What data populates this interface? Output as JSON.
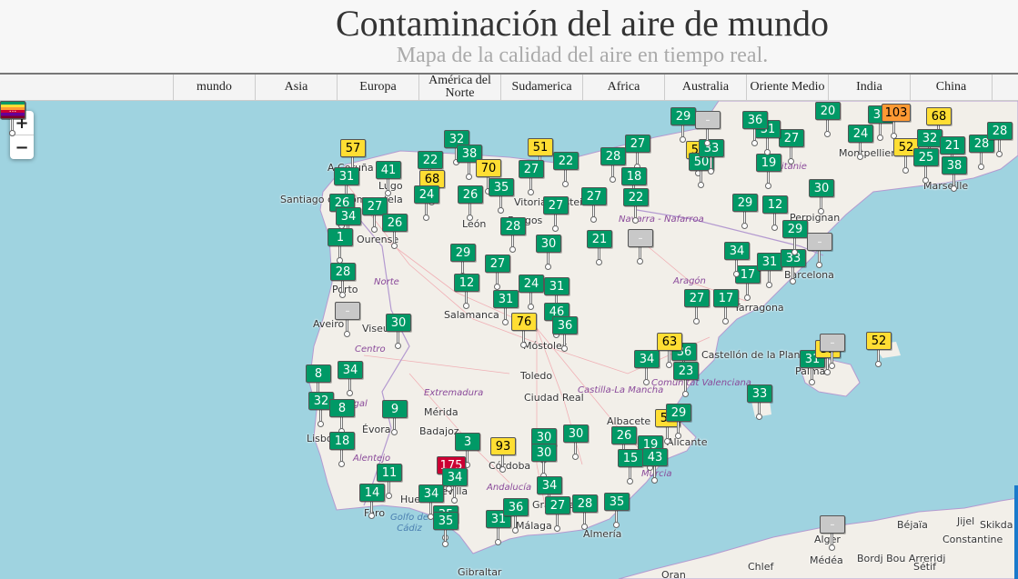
{
  "header": {
    "title": "Contaminación del aire de mundo",
    "subtitle": "Mapa de la calidad del aire en tiempo real."
  },
  "nav": {
    "items": [
      {
        "label": "mundo"
      },
      {
        "label": "Asia"
      },
      {
        "label": "Europa"
      },
      {
        "label": "América del Norte"
      },
      {
        "label": "Sudamerica"
      },
      {
        "label": "Africa"
      },
      {
        "label": "Australia"
      },
      {
        "label": "Oriente Medio"
      },
      {
        "label": "India"
      },
      {
        "label": "China"
      },
      {
        "label": ""
      }
    ]
  },
  "map": {
    "zoom_in_label": "+",
    "zoom_out_label": "−",
    "colors": {
      "good": "#009966",
      "moderate": "#ffde33",
      "unhealthy_sensitive": "#ff9933",
      "unhealthy": "#cc0033",
      "sea": "#9fd3e0",
      "land": "#f2efe9"
    },
    "places": [
      {
        "name": "A Coruña"
      },
      {
        "name": "Lugo"
      },
      {
        "name": "Santiago de Compostela"
      },
      {
        "name": "Ourense"
      },
      {
        "name": "León"
      },
      {
        "name": "Vitoria-Gasteiz"
      },
      {
        "name": "Burgos"
      },
      {
        "name": "Salamanca"
      },
      {
        "name": "Porto"
      },
      {
        "name": "Aveiro"
      },
      {
        "name": "Viseu"
      },
      {
        "name": "Móstoles"
      },
      {
        "name": "Toledo"
      },
      {
        "name": "Ciudad Real"
      },
      {
        "name": "Mérida"
      },
      {
        "name": "Badajoz"
      },
      {
        "name": "Évora"
      },
      {
        "name": "Lisboa"
      },
      {
        "name": "Córdoba"
      },
      {
        "name": "Sevilla"
      },
      {
        "name": "Huelva"
      },
      {
        "name": "Faro"
      },
      {
        "name": "Albacete"
      },
      {
        "name": "Alicante"
      },
      {
        "name": "Málaga"
      },
      {
        "name": "Almería"
      },
      {
        "name": "Granada"
      },
      {
        "name": "Gibraltar"
      },
      {
        "name": "Tarragona"
      },
      {
        "name": "Barcelona"
      },
      {
        "name": "Perpignan"
      },
      {
        "name": "Montpellier"
      },
      {
        "name": "Marseille"
      },
      {
        "name": "Palma"
      },
      {
        "name": "Castellón de la Plana"
      },
      {
        "name": "Alger"
      },
      {
        "name": "Béjaïa"
      },
      {
        "name": "Jijel"
      },
      {
        "name": "Skikda"
      },
      {
        "name": "Constantine"
      },
      {
        "name": "Chlef"
      },
      {
        "name": "Médéa"
      },
      {
        "name": "Bordj Bou Arreridj"
      },
      {
        "name": "Sétif"
      },
      {
        "name": "Oran"
      }
    ],
    "regions": [
      {
        "name": "Norte"
      },
      {
        "name": "Centro"
      },
      {
        "name": "Alentejo"
      },
      {
        "name": "Extremadura"
      },
      {
        "name": "Castilla-La Mancha"
      },
      {
        "name": "Andalucía"
      },
      {
        "name": "Aragón"
      },
      {
        "name": "Navarra - Nafarroa"
      },
      {
        "name": "Comunitat Valenciana"
      },
      {
        "name": "Murcia"
      },
      {
        "name": "Occitanie"
      },
      {
        "name": "Portugal"
      }
    ],
    "sea_labels": [
      {
        "name": "Golfo de Cádiz"
      }
    ],
    "markers": [
      {
        "value": "57",
        "level": "moderate"
      },
      {
        "value": "31",
        "level": "good"
      },
      {
        "value": "41",
        "level": "good"
      },
      {
        "value": "26",
        "level": "good"
      },
      {
        "value": "27",
        "level": "good"
      },
      {
        "value": "34",
        "level": "good"
      },
      {
        "value": "26",
        "level": "good"
      },
      {
        "value": "1",
        "level": "good"
      },
      {
        "value": "32",
        "level": "good"
      },
      {
        "value": "22",
        "level": "good"
      },
      {
        "value": "38",
        "level": "good"
      },
      {
        "value": "68",
        "level": "moderate"
      },
      {
        "value": "70",
        "level": "moderate"
      },
      {
        "value": "24",
        "level": "good"
      },
      {
        "value": "26",
        "level": "good"
      },
      {
        "value": "35",
        "level": "good"
      },
      {
        "value": "28",
        "level": "good"
      },
      {
        "value": "51",
        "level": "moderate"
      },
      {
        "value": "27",
        "level": "good"
      },
      {
        "value": "27",
        "level": "good"
      },
      {
        "value": "22",
        "level": "good"
      },
      {
        "value": "28",
        "level": "good"
      },
      {
        "value": "27",
        "level": "good"
      },
      {
        "value": "27",
        "level": "good"
      },
      {
        "value": "18",
        "level": "good"
      },
      {
        "value": "22",
        "level": "good"
      },
      {
        "value": "21",
        "level": "good"
      },
      {
        "value": "30",
        "level": "good"
      },
      {
        "value": "29",
        "level": "good"
      },
      {
        "value": "27",
        "level": "good"
      },
      {
        "value": "12",
        "level": "good"
      },
      {
        "value": "24",
        "level": "good"
      },
      {
        "value": "31",
        "level": "good"
      },
      {
        "value": "31",
        "level": "good"
      },
      {
        "value": "46",
        "level": "good"
      },
      {
        "value": "76",
        "level": "moderate"
      },
      {
        "value": "36",
        "level": "good"
      },
      {
        "value": "28",
        "level": "good"
      },
      {
        "value": "30",
        "level": "good"
      },
      {
        "value": "8",
        "level": "good"
      },
      {
        "value": "34",
        "level": "good"
      },
      {
        "value": "32",
        "level": "good"
      },
      {
        "value": "8",
        "level": "good"
      },
      {
        "value": "9",
        "level": "good"
      },
      {
        "value": "18",
        "level": "good"
      },
      {
        "value": "3",
        "level": "good"
      },
      {
        "value": "93",
        "level": "moderate"
      },
      {
        "value": "30",
        "level": "good"
      },
      {
        "value": "30",
        "level": "good"
      },
      {
        "value": "30",
        "level": "good"
      },
      {
        "value": "175",
        "level": "unhealthy"
      },
      {
        "value": "11",
        "level": "good"
      },
      {
        "value": "14",
        "level": "good"
      },
      {
        "value": "34",
        "level": "good"
      },
      {
        "value": "34",
        "level": "good"
      },
      {
        "value": "35",
        "level": "good"
      },
      {
        "value": "35",
        "level": "good"
      },
      {
        "value": "31",
        "level": "good"
      },
      {
        "value": "36",
        "level": "good"
      },
      {
        "value": "34",
        "level": "good"
      },
      {
        "value": "27",
        "level": "good"
      },
      {
        "value": "28",
        "level": "good"
      },
      {
        "value": "35",
        "level": "good"
      },
      {
        "value": "26",
        "level": "good"
      },
      {
        "value": "19",
        "level": "good"
      },
      {
        "value": "15",
        "level": "good"
      },
      {
        "value": "43",
        "level": "good"
      },
      {
        "value": "55",
        "level": "moderate"
      },
      {
        "value": "29",
        "level": "good"
      },
      {
        "value": "34",
        "level": "good"
      },
      {
        "value": "36",
        "level": "good"
      },
      {
        "value": "63",
        "level": "moderate"
      },
      {
        "value": "23",
        "level": "good"
      },
      {
        "value": "27",
        "level": "good"
      },
      {
        "value": "17",
        "level": "good"
      },
      {
        "value": "17",
        "level": "good"
      },
      {
        "value": "31",
        "level": "good"
      },
      {
        "value": "33",
        "level": "good"
      },
      {
        "value": "34",
        "level": "good"
      },
      {
        "value": "29",
        "level": "good"
      },
      {
        "value": "12",
        "level": "good"
      },
      {
        "value": "29",
        "level": "good"
      },
      {
        "value": "30",
        "level": "good"
      },
      {
        "value": "19",
        "level": "good"
      },
      {
        "value": "27",
        "level": "good"
      },
      {
        "value": "31",
        "level": "good"
      },
      {
        "value": "29",
        "level": "good"
      },
      {
        "value": "51",
        "level": "moderate"
      },
      {
        "value": "50",
        "level": "good"
      },
      {
        "value": "20",
        "level": "good"
      },
      {
        "value": "24",
        "level": "good"
      },
      {
        "value": "33",
        "level": "good"
      },
      {
        "value": "103",
        "level": "unhealthy_sensitive"
      },
      {
        "value": "68",
        "level": "moderate"
      },
      {
        "value": "52",
        "level": "moderate"
      },
      {
        "value": "32",
        "level": "good"
      },
      {
        "value": "25",
        "level": "good"
      },
      {
        "value": "21",
        "level": "good"
      },
      {
        "value": "38",
        "level": "good"
      },
      {
        "value": "28",
        "level": "good"
      },
      {
        "value": "28",
        "level": "good"
      },
      {
        "value": "31",
        "level": "good"
      },
      {
        "value": "53",
        "level": "moderate"
      },
      {
        "value": "52",
        "level": "moderate"
      },
      {
        "value": "33",
        "level": "good"
      },
      {
        "value": "36",
        "level": "good"
      },
      {
        "value": "33",
        "level": "good"
      },
      {
        "value": "–",
        "level": "na"
      },
      {
        "value": "–",
        "level": "na"
      },
      {
        "value": "–",
        "level": "na"
      },
      {
        "value": "–",
        "level": "na"
      },
      {
        "value": "–",
        "level": "na"
      },
      {
        "value": "–",
        "level": "na"
      },
      {
        "value": "–",
        "level": "na"
      },
      {
        "value": "...",
        "level": "multi"
      }
    ]
  }
}
